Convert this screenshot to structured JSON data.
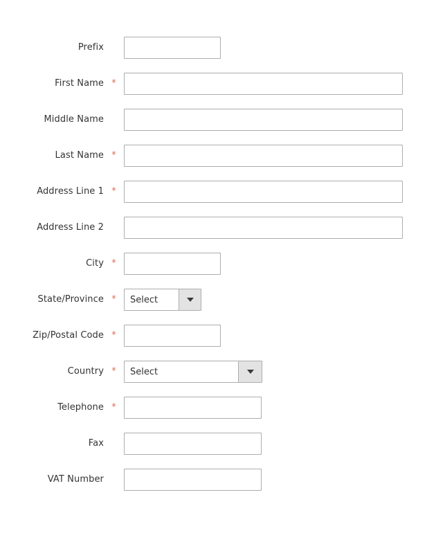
{
  "form": {
    "name": "customer-address-form",
    "colors": {
      "background": "#ffffff",
      "label_text": "#333333",
      "input_border": "#adadad",
      "required_asterisk": "#e06e56",
      "dropdown_button_bg": "#e3e3e3",
      "dropdown_arrow": "#3a3a3a"
    },
    "required_marker": "*",
    "fields": [
      {
        "name": "prefix",
        "label": "Prefix",
        "type": "text",
        "required": false,
        "value": "",
        "placeholder": "",
        "width": "narrow"
      },
      {
        "name": "first-name",
        "label": "First Name",
        "type": "text",
        "required": true,
        "value": "",
        "placeholder": "",
        "width": "wide"
      },
      {
        "name": "middle-name",
        "label": "Middle Name",
        "type": "text",
        "required": false,
        "value": "",
        "placeholder": "",
        "width": "wide"
      },
      {
        "name": "last-name",
        "label": "Last Name",
        "type": "text",
        "required": true,
        "value": "",
        "placeholder": "",
        "width": "wide"
      },
      {
        "name": "address-line-1",
        "label": "Address Line 1",
        "type": "text",
        "required": true,
        "value": "",
        "placeholder": "",
        "width": "wide"
      },
      {
        "name": "address-line-2",
        "label": "Address Line 2",
        "type": "text",
        "required": false,
        "value": "",
        "placeholder": "",
        "width": "wide"
      },
      {
        "name": "city",
        "label": "City",
        "type": "text",
        "required": true,
        "value": "",
        "placeholder": "",
        "width": "narrow"
      },
      {
        "name": "state-province",
        "label": "State/Province",
        "type": "select",
        "required": true,
        "value": "Select",
        "width": "state"
      },
      {
        "name": "zip-postal-code",
        "label": "Zip/Postal Code",
        "type": "text",
        "required": true,
        "value": "",
        "placeholder": "",
        "width": "narrow"
      },
      {
        "name": "country",
        "label": "Country",
        "type": "select",
        "required": true,
        "value": "Select",
        "width": "country"
      },
      {
        "name": "telephone",
        "label": "Telephone",
        "type": "text",
        "required": true,
        "value": "",
        "placeholder": "",
        "width": "medium"
      },
      {
        "name": "fax",
        "label": "Fax",
        "type": "text",
        "required": false,
        "value": "",
        "placeholder": "",
        "width": "medium"
      },
      {
        "name": "vat-number",
        "label": "VAT Number",
        "type": "text",
        "required": false,
        "value": "",
        "placeholder": "",
        "width": "medium"
      }
    ]
  }
}
